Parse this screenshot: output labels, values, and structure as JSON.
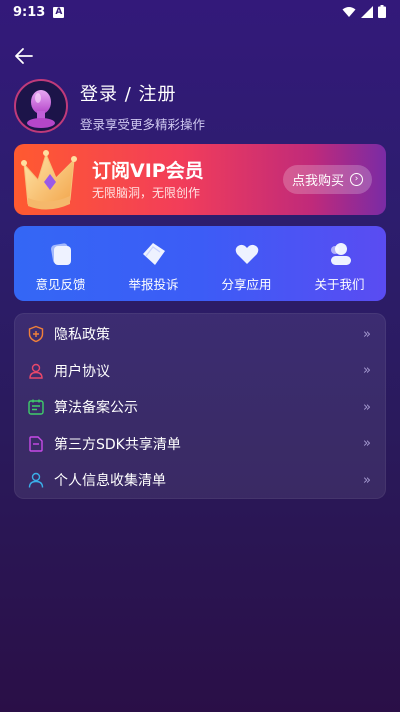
{
  "status_bar": {
    "time": "9:13",
    "notification_letter": "A"
  },
  "profile": {
    "title": "登录 / 注册",
    "subtitle": "登录享受更多精彩操作"
  },
  "vip": {
    "title": "订阅VIP会员",
    "subtitle": "无限脑洞，无限创作",
    "button_label": "点我购买"
  },
  "quick_actions": [
    {
      "label": "意见反馈",
      "icon": "feedback-icon"
    },
    {
      "label": "举报投诉",
      "icon": "report-icon"
    },
    {
      "label": "分享应用",
      "icon": "share-heart-icon"
    },
    {
      "label": "关于我们",
      "icon": "about-users-icon"
    }
  ],
  "menu": [
    {
      "label": "隐私政策",
      "icon": "privacy-shield-icon",
      "color": "#f0803a"
    },
    {
      "label": "用户协议",
      "icon": "user-agreement-icon",
      "color": "#e8476a"
    },
    {
      "label": "算法备案公示",
      "icon": "algorithm-record-icon",
      "color": "#3fce6a"
    },
    {
      "label": "第三方SDK共享清单",
      "icon": "sdk-list-icon",
      "color": "#c84be8"
    },
    {
      "label": "个人信息收集清单",
      "icon": "personal-info-icon",
      "color": "#3aaee8"
    }
  ],
  "menu_arrow": "»",
  "colors": {
    "vip_gradient_start": "#ff5a30",
    "quick_actions_bg": "#3467f5",
    "background": "#2d1d6e"
  }
}
